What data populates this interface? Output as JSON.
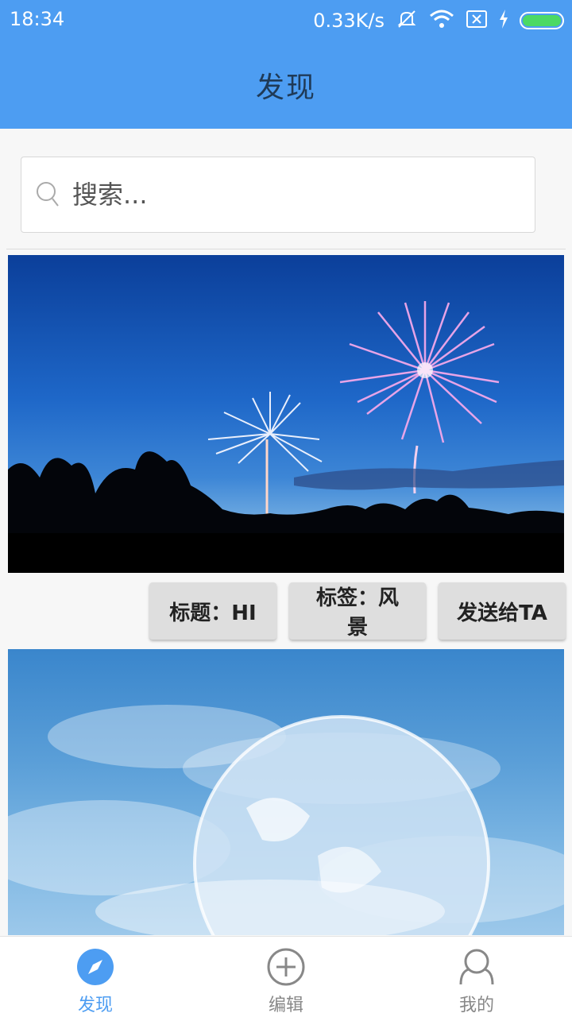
{
  "status_bar": {
    "time": "18:34",
    "net_speed": "0.33K/s",
    "icons": [
      "mute-icon",
      "wifi-icon",
      "no-sim-icon",
      "charging-icon",
      "battery-icon"
    ]
  },
  "app_bar": {
    "title": "发现"
  },
  "search": {
    "placeholder": "搜索..."
  },
  "feed": [
    {
      "image": "fireworks-photo",
      "chips": {
        "title": "标题：HI",
        "tag": "标签：风景",
        "send": "发送给TA"
      }
    },
    {
      "image": "earth-clouds-photo"
    }
  ],
  "tabs": [
    {
      "label": "发现",
      "icon": "compass-icon",
      "active": true
    },
    {
      "label": "编辑",
      "icon": "add-circle-icon",
      "active": false
    },
    {
      "label": "我的",
      "icon": "person-icon",
      "active": false
    }
  ],
  "colors": {
    "accent": "#4d9df2",
    "title_text": "#1f3a57",
    "chip_bg": "#dedede"
  }
}
